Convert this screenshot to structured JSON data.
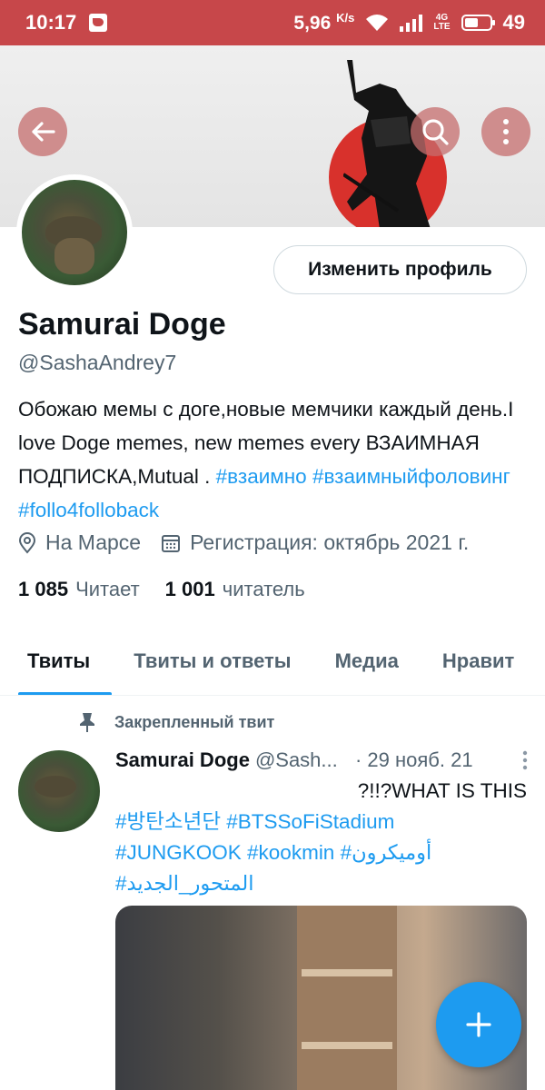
{
  "status_bar": {
    "time": "10:17",
    "net_speed": "5,96",
    "net_unit": "K/s",
    "network_type": "4G",
    "lte": "LTE",
    "battery": "49"
  },
  "profile": {
    "edit_label": "Изменить профиль",
    "name": "Samurai Doge",
    "handle": "@SashaAndrey7",
    "bio": {
      "text": "Обожаю мемы с доге,новые мемчики каждый день.I love Doge memes, new memes every ВЗАИМНАЯ ПОДПИСКА,Mutual . ",
      "tags": [
        "#взаимно",
        "#взаимныйфоловинг",
        "#follo4folloback"
      ]
    },
    "location": "На Марсе",
    "joined": "Регистрация: октябрь 2021 г.",
    "following_count": "1 085",
    "following_label": "Читает",
    "followers_count": "1 001",
    "followers_label": "читатель"
  },
  "tabs": [
    {
      "label": "Твиты",
      "active": true
    },
    {
      "label": "Твиты и ответы",
      "active": false
    },
    {
      "label": "Медиа",
      "active": false
    },
    {
      "label": "Нравит",
      "active": false
    }
  ],
  "pinned_tweet": {
    "pinned_label": "Закрепленный твит",
    "author": "Samurai Doge",
    "handle": "@Sash...",
    "date": "· 29 нояб. 21",
    "text_line": "?!!?WHAT IS THIS",
    "tags_line1": "#방탄소년단 #BTSSoFiStadium",
    "tags_line2_a": "#JUNGKOOK #kookmin ",
    "tags_line2_b": "#أوميكرون",
    "tags_line3": "#المتحور_الجديد"
  },
  "colors": {
    "status_bar": "#c7474a",
    "accent": "#1d9bf0",
    "secondary_text": "#536471"
  }
}
